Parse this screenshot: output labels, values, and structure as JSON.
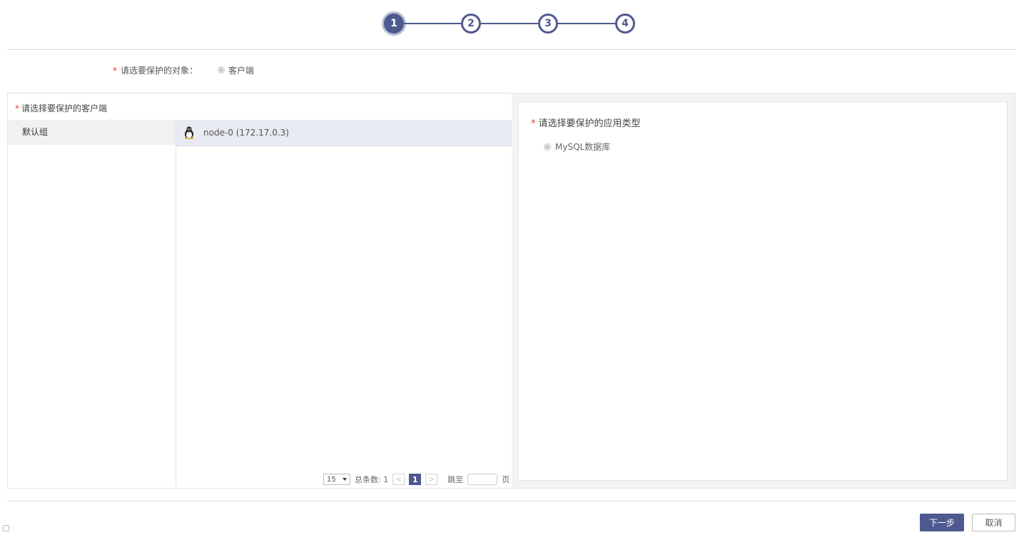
{
  "stepper": {
    "steps": [
      "1",
      "2",
      "3",
      "4"
    ],
    "active_step": 1
  },
  "target": {
    "required_mark": "*",
    "label": "请选要保护的对象：",
    "option": "客户端"
  },
  "clients_panel": {
    "required_mark": "*",
    "title": "请选择要保护的客户端",
    "groups": [
      {
        "label": "默认组"
      }
    ],
    "clients": [
      {
        "label": "node-0 (172.17.0.3)",
        "icon": "linux-penguin-icon"
      }
    ],
    "pagination": {
      "page_size": "15",
      "total_label": "总条数: 1",
      "current_page": "1",
      "prev_icon": "<",
      "next_icon": ">",
      "jump_label": "跳至",
      "page_suffix": "页"
    }
  },
  "app_panel": {
    "required_mark": "*",
    "title": "请选择要保护的应用类型",
    "option": "MySQL数据库"
  },
  "footer": {
    "next_label": "下一步",
    "cancel_label": "取消"
  },
  "colors": {
    "accent": "#4e5a8f",
    "required": "#e8382b"
  }
}
